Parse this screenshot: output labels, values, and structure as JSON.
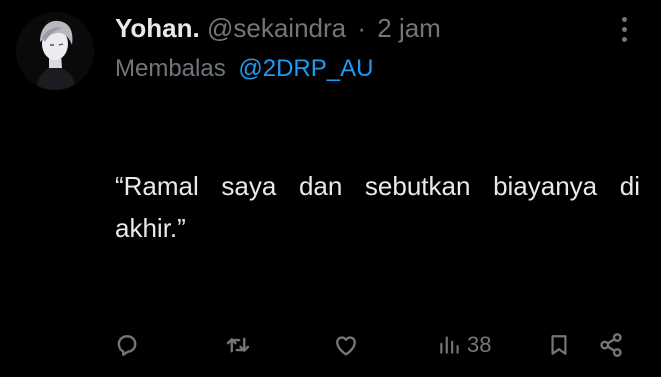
{
  "author": {
    "name": "Yohan.",
    "handle": "@sekaindra",
    "time": "2 jam",
    "separator": "·"
  },
  "reply": {
    "prefix": "Membalas",
    "mention": "@2DRP_AU"
  },
  "tweet_text": "“Ramal saya dan sebutkan biayanya di akhir.”",
  "stats": {
    "views": "38"
  },
  "icons": {
    "more": "more-vertical-icon",
    "reply": "comment-icon",
    "retweet": "retweet-icon",
    "like": "heart-icon",
    "views": "analytics-icon",
    "bookmark": "bookmark-icon",
    "share": "share-icon"
  },
  "colors": {
    "background": "#000000",
    "text": "#e7e9ea",
    "muted": "#71767b",
    "link": "#1d9bf0"
  }
}
